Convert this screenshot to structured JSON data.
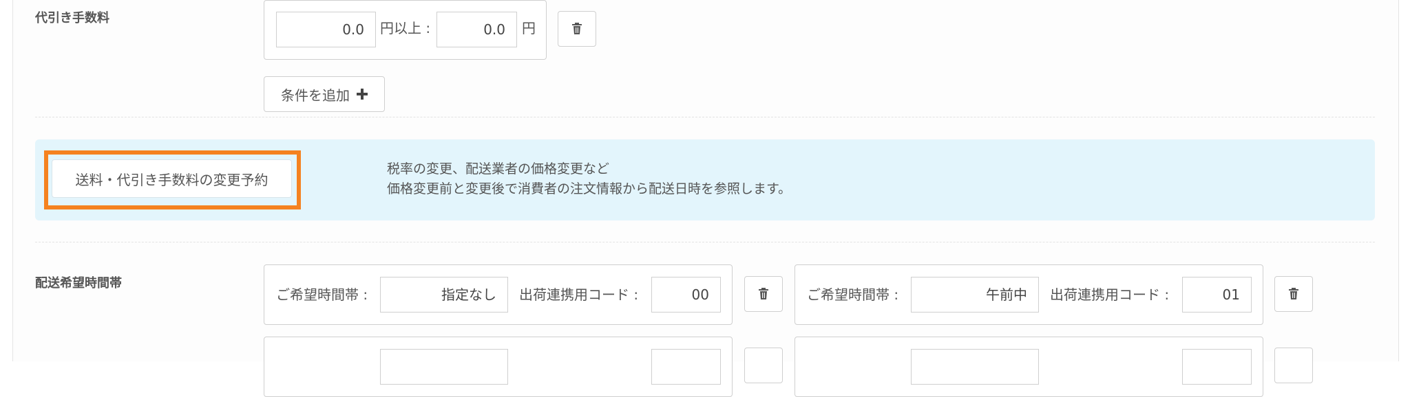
{
  "cod_fee": {
    "label": "代引き手数料",
    "amount_from": "0.0",
    "unit_above": "円以上 :",
    "amount_fee": "0.0",
    "unit_yen": "円",
    "add_condition_label": "条件を追加"
  },
  "reservation": {
    "button_label": "送料・代引き手数料の変更予約",
    "description_line1": "税率の変更、配送業者の価格変更など",
    "description_line2": "価格変更前と変更後で消費者の注文情報から配送日時を参照します。"
  },
  "delivery_time": {
    "label": "配送希望時間帯",
    "slot_label": "ご希望時間帯 :",
    "code_label": "出荷連携用コード :",
    "slots": [
      {
        "time": "指定なし",
        "code": "00"
      },
      {
        "time": "午前中",
        "code": "01"
      }
    ]
  },
  "colors": {
    "highlight": "#f58220",
    "info_bg": "#e3f5fc"
  },
  "icons": [
    "trash-icon",
    "plus-icon"
  ]
}
